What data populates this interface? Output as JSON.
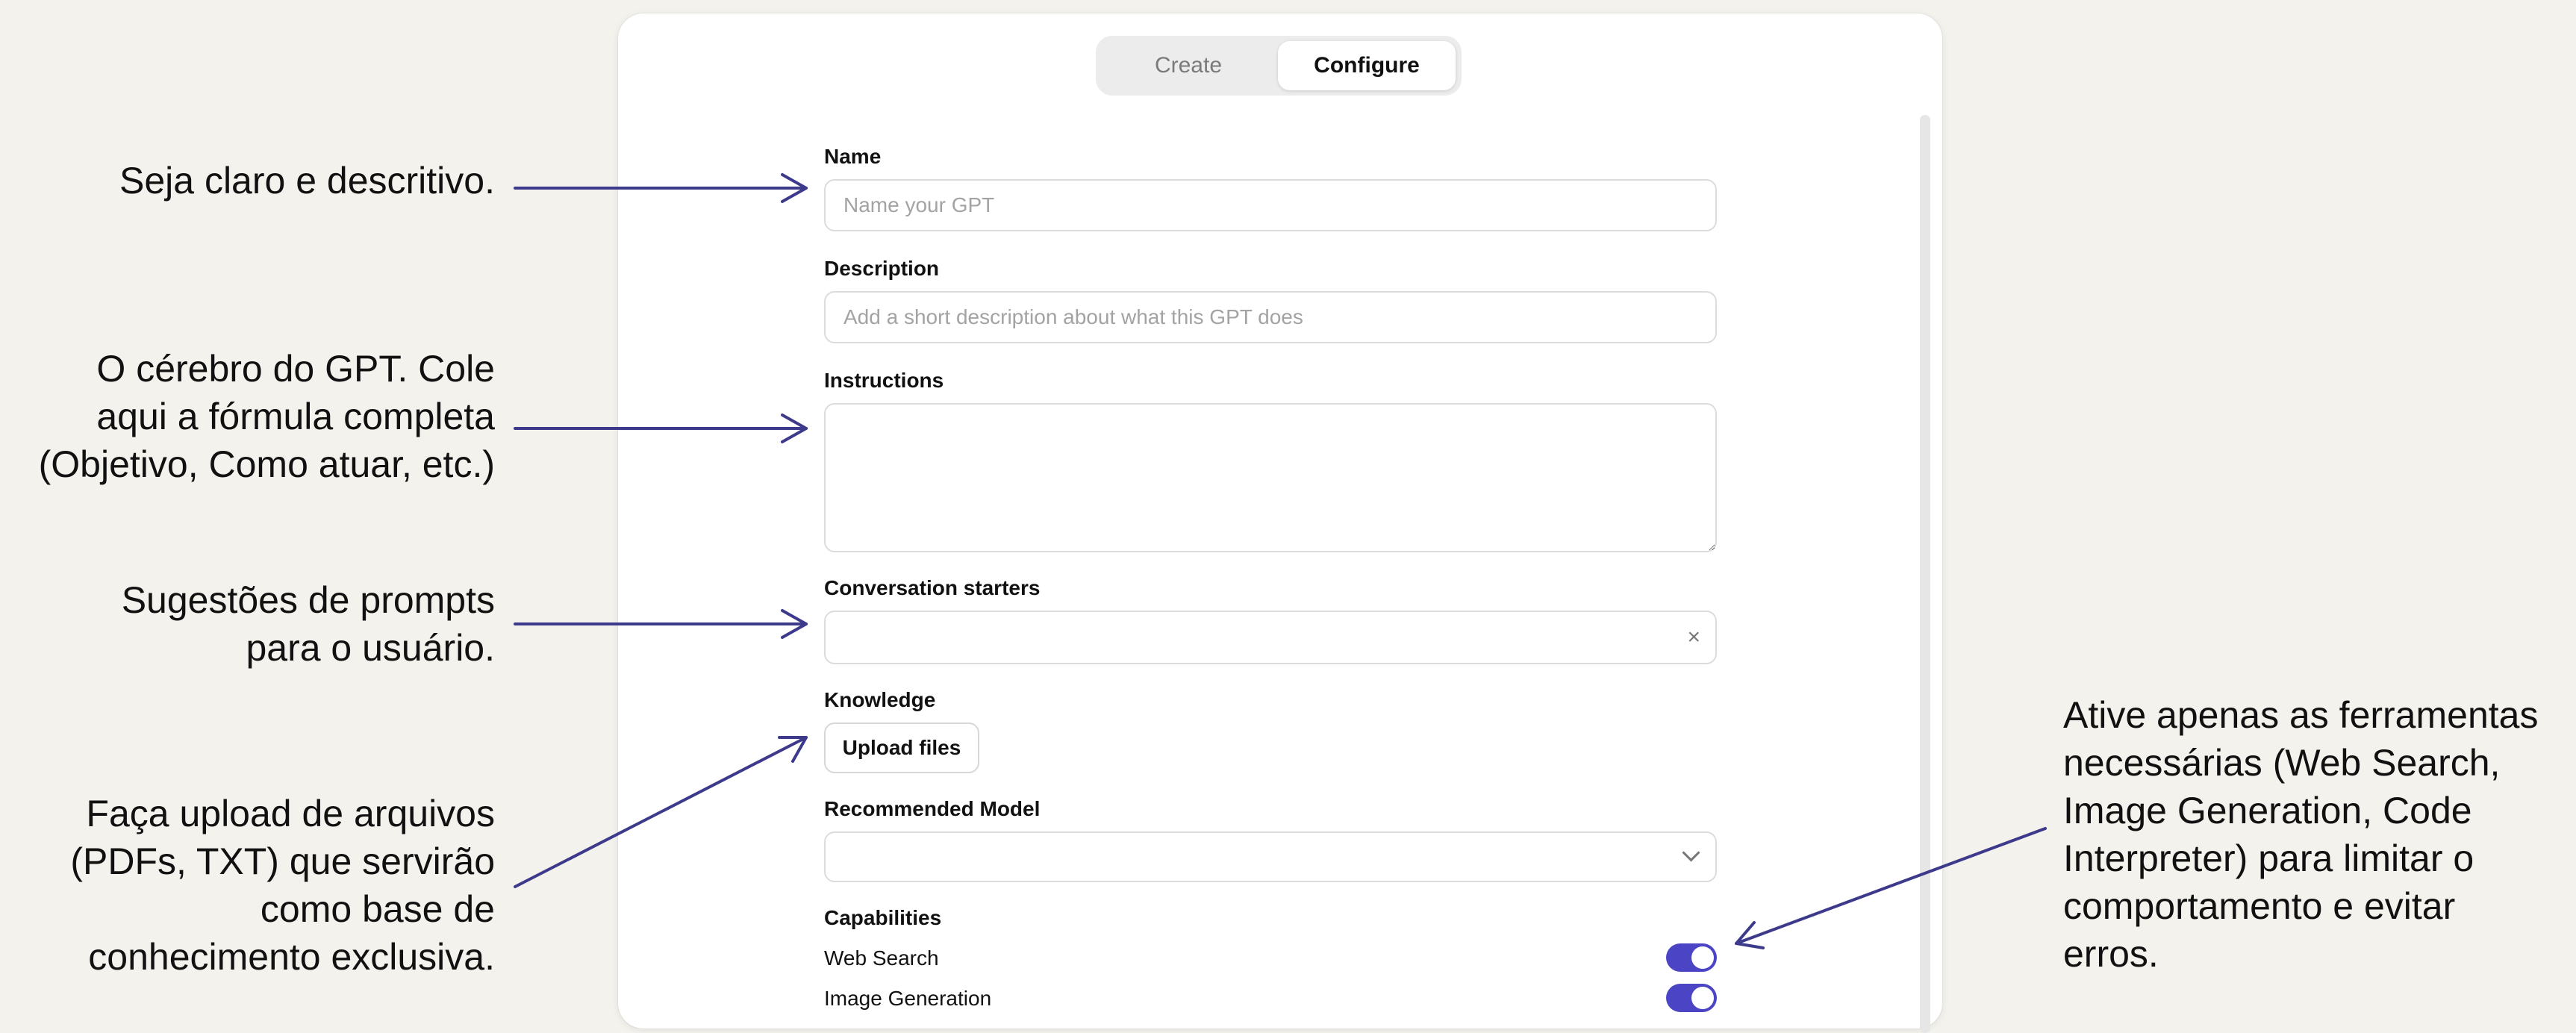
{
  "tabs": [
    {
      "label": "Create",
      "active": false
    },
    {
      "label": "Configure",
      "active": true
    }
  ],
  "form": {
    "name_label": "Name",
    "name_placeholder": "Name your GPT",
    "description_label": "Description",
    "description_placeholder": "Add a short description about what this GPT does",
    "instructions_label": "Instructions",
    "starters_label": "Conversation starters",
    "starters_clear": "×",
    "knowledge_label": "Knowledge",
    "upload_label": "Upload files",
    "model_label": "Recommended Model",
    "capabilities_label": "Capabilities",
    "capabilities": [
      {
        "label": "Web Search",
        "enabled": true
      },
      {
        "label": "Image Generation",
        "enabled": true
      }
    ]
  },
  "annotations": {
    "name": [
      "Seja claro e descritivo."
    ],
    "instructions": [
      "O cérebro do GPT. Cole",
      "aqui a fórmula completa",
      "(Objetivo, Como atuar, etc.)"
    ],
    "starters": [
      "Sugestões de prompts",
      "para o usuário."
    ],
    "knowledge": [
      "Faça upload de arquivos",
      "(PDFs, TXT) que servirão",
      "como base de",
      "conhecimento exclusiva."
    ],
    "capabilities": [
      "Ative apenas as ferramentas",
      "necessárias (Web Search,",
      "Image Generation, Code",
      "Interpreter) para limitar o",
      "comportamento e evitar",
      "erros."
    ]
  },
  "colors": {
    "arrow": "#3d3a8c",
    "toggle": "#4b45c6",
    "background": "#f4f2ed"
  }
}
